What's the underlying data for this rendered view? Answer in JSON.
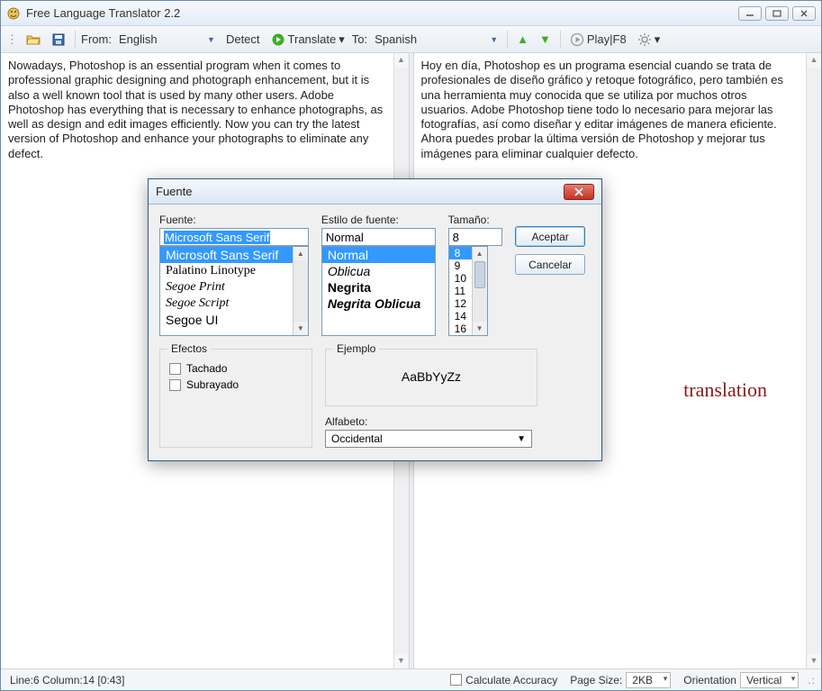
{
  "window": {
    "title": "Free Language Translator 2.2"
  },
  "toolbar": {
    "from_label": "From:",
    "from_lang": "English",
    "detect_label": "Detect",
    "translate_label": "Translate",
    "to_label": "To:",
    "to_lang": "Spanish",
    "play_label": "Play|F8"
  },
  "panes": {
    "left_text": "Nowadays, Photoshop is an essential program when it comes to professional graphic designing and photograph enhancement, but it is also a well known tool that is used by many other users. Adobe Photoshop has everything that is necessary to enhance photographs, as well as design and edit images efficiently. Now you can try the latest version of Photoshop and enhance your photographs to eliminate any defect.",
    "right_text": "Hoy en día, Photoshop es un programa esencial cuando se trata de profesionales de diseño gráfico y retoque fotográfico, pero también es una herramienta muy conocida que se utiliza por muchos otros usuarios. Adobe Photoshop tiene todo lo necesario para mejorar las fotografías, así como diseñar y editar imágenes de manera eficiente. Ahora puedes probar la última versión de Photoshop y mejorar tus imágenes para eliminar cualquier defecto.",
    "watermark": "translation"
  },
  "statusbar": {
    "position": "Line:6 Column:14 [0:43]",
    "calc_accuracy": "Calculate Accuracy",
    "page_size_label": "Page Size:",
    "page_size_value": "2KB",
    "orientation_label": "Orientation",
    "orientation_value": "Vertical"
  },
  "dialog": {
    "title": "Fuente",
    "font_label": "Fuente:",
    "font_value": "Microsoft Sans Serif",
    "fonts": [
      "Microsoft Sans Serif",
      "Palatino Linotype",
      "Segoe Print",
      "Segoe Script",
      "Segoe UI"
    ],
    "style_label": "Estilo de fuente:",
    "style_value": "Normal",
    "styles": [
      "Normal",
      "Oblicua",
      "Negrita",
      "Negrita Oblicua"
    ],
    "size_label": "Tamaño:",
    "size_value": "8",
    "sizes": [
      "8",
      "9",
      "10",
      "11",
      "12",
      "14",
      "16"
    ],
    "ok": "Aceptar",
    "cancel": "Cancelar",
    "effects_label": "Efectos",
    "strike": "Tachado",
    "underline": "Subrayado",
    "example_label": "Ejemplo",
    "example_text": "AaBbYyZz",
    "alphabet_label": "Alfabeto:",
    "alphabet_value": "Occidental"
  }
}
